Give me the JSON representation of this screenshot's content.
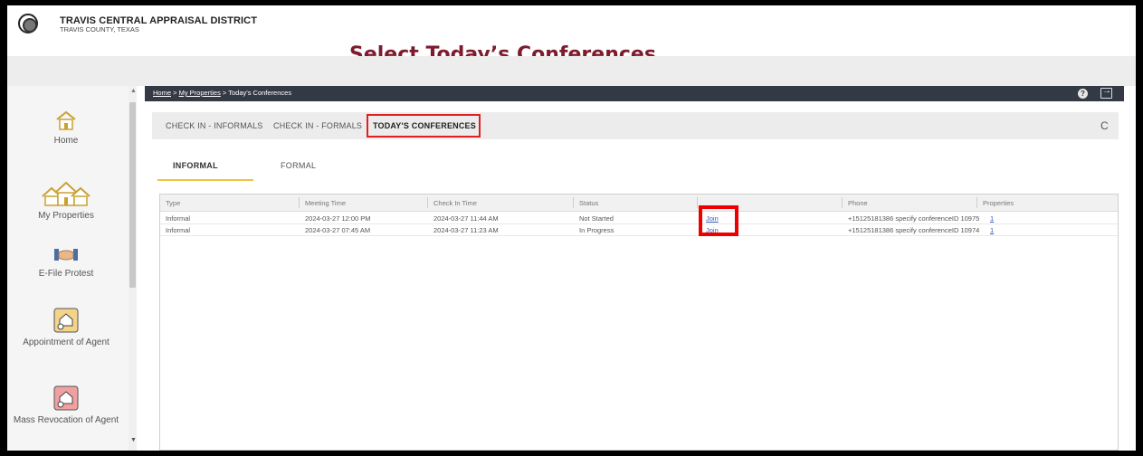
{
  "header": {
    "org_name": "TRAVIS CENTRAL APPRAISAL DISTRICT",
    "org_subtitle": "TRAVIS COUNTY, TEXAS",
    "overlay_title": "Select Today’s Conferences"
  },
  "sidebar": {
    "items": [
      {
        "label": "Home",
        "icon": "home-icon"
      },
      {
        "label": "My Properties",
        "icon": "properties-icon"
      },
      {
        "label": "E-File Protest",
        "icon": "handshake-icon"
      },
      {
        "label": "Appointment of Agent",
        "icon": "agent-house-icon"
      },
      {
        "label": "Mass Revocation of Agent",
        "icon": "revoke-agent-icon"
      }
    ]
  },
  "breadcrumb": {
    "home": "Home",
    "sep1": " > ",
    "my_properties": "My Properties",
    "sep2": " > ",
    "current": "Today's Conferences"
  },
  "toolbar": {
    "help_icon": "help-icon",
    "logout_icon": "logout-icon",
    "help_glyph": "?"
  },
  "tabs": [
    {
      "label": "CHECK IN - INFORMALS"
    },
    {
      "label": "CHECK IN - FORMALS"
    },
    {
      "label": "TODAY'S CONFERENCES"
    }
  ],
  "refresh_glyph": "C",
  "sub_tabs": [
    {
      "label": "INFORMAL"
    },
    {
      "label": "FORMAL"
    }
  ],
  "table": {
    "columns": [
      "Type",
      "Meeting Time",
      "Check In Time",
      "Status",
      "",
      "Phone",
      "Properties"
    ],
    "rows": [
      {
        "type": "Informal",
        "meeting": "2024-03-27 12:00 PM",
        "checkin": "2024-03-27 11:44 AM",
        "status": "Not Started",
        "join": "Join",
        "phone": "+15125181386 specify conferenceID 10975",
        "properties": "1"
      },
      {
        "type": "Informal",
        "meeting": "2024-03-27 07:45 AM",
        "checkin": "2024-03-27 11:23 AM",
        "status": "In Progress",
        "join": "Join",
        "phone": "+15125181386 specify conferenceID 10974",
        "properties": "1"
      }
    ]
  },
  "colors": {
    "accent_title": "#7d1c2e",
    "highlight": "#ee0000",
    "tab_underline": "#f0c24a",
    "breadcrumb_bg": "#333945"
  }
}
